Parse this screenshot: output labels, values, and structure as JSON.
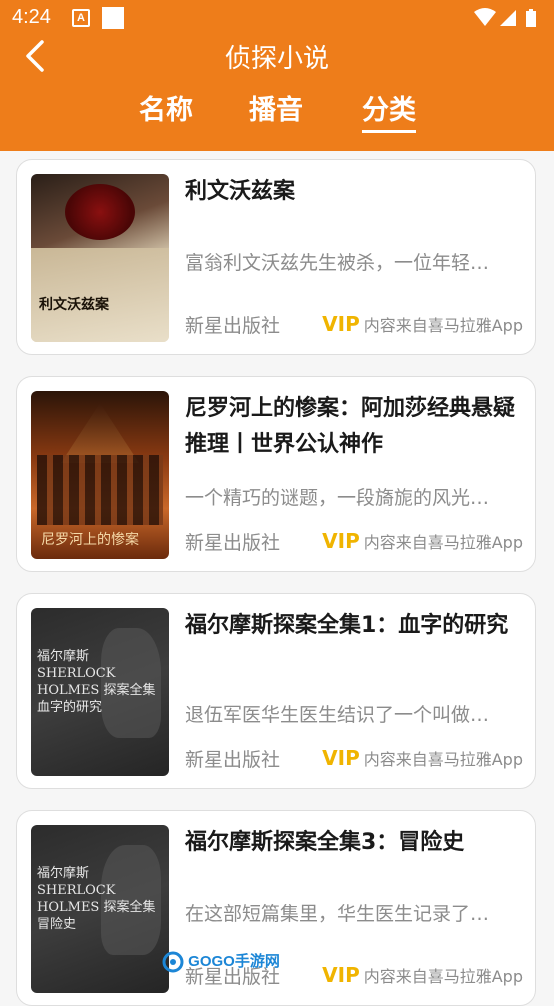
{
  "status_bar": {
    "time": "4:24",
    "notification_letter": "A"
  },
  "header": {
    "title": "侦探小说",
    "back_icon": "chevron-left-icon"
  },
  "tabs": [
    {
      "label": "名称",
      "active": false
    },
    {
      "label": "播音",
      "active": false
    },
    {
      "label": "分类",
      "active": true
    }
  ],
  "books": [
    {
      "title": "利文沃兹案",
      "description": "富翁利文沃兹先生被杀，一位年轻…",
      "publisher": "新星出版社",
      "vip": "VIP",
      "source": "内容来自喜马拉雅App",
      "cover_text": "利文沃兹案"
    },
    {
      "title": "尼罗河上的惨案：阿加莎经典悬疑推理丨世界公认神作",
      "description": "一个精巧的谜题，一段旖旎的风光…",
      "publisher": "新星出版社",
      "vip": "VIP",
      "source": "内容来自喜马拉雅App",
      "cover_text": "尼罗河上的惨案"
    },
    {
      "title": "福尔摩斯探案全集1：血字的研究",
      "description": "退伍军医华生医生结识了一个叫做…",
      "publisher": "新星出版社",
      "vip": "VIP",
      "source": "内容来自喜马拉雅App",
      "cover_text": "福尔摩斯 SHERLOCK HOLMES 探案全集 血字的研究"
    },
    {
      "title": "福尔摩斯探案全集3：冒险史",
      "description": "在这部短篇集里，华生医生记录了…",
      "publisher": "新星出版社",
      "vip": "VIP",
      "source": "内容来自喜马拉雅App",
      "cover_text": "福尔摩斯 SHERLOCK HOLMES 探案全集 冒险史"
    }
  ],
  "watermark": "GOGO手游网",
  "colors": {
    "header": "#ee7d1a",
    "vip": "#f0b400",
    "text_dark": "#1a1a1a",
    "text_gray": "#8c8c8c"
  }
}
